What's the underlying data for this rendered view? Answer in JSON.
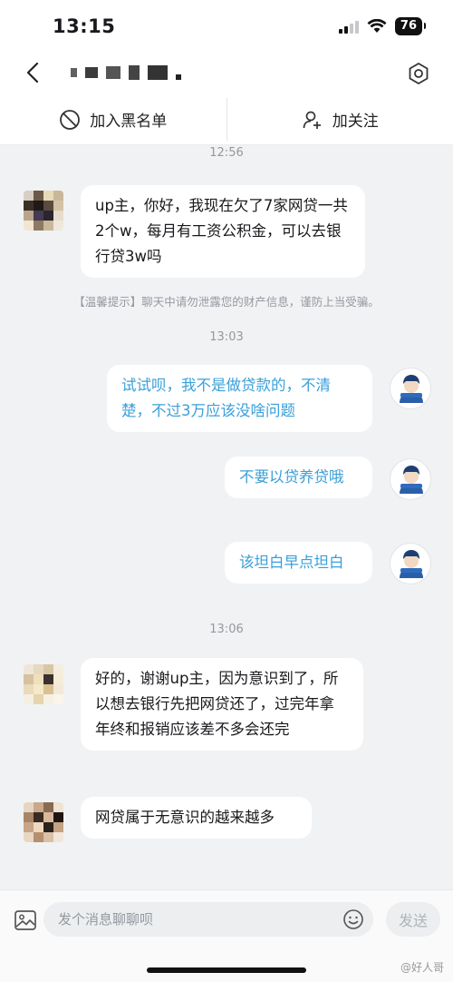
{
  "status": {
    "time": "13:15",
    "battery": "76"
  },
  "nav": {
    "title": "",
    "back_icon": "chevron-left-icon",
    "settings_icon": "hexagon-settings-icon"
  },
  "actions": {
    "block_label": "加入黑名单",
    "follow_label": "加关注"
  },
  "messages": {
    "ts1": "12:56",
    "m1": "up主，你好，我现在欠了7家网贷一共2个w，每月有工资公积金，可以去银行贷3w吗",
    "notice": "【温馨提示】聊天中请勿泄露您的财产信息，谨防上当受骗。",
    "ts2": "13:03",
    "m2": "试试呗，我不是做贷款的，不清楚，不过3万应该没啥问题",
    "m3": "不要以贷养贷哦",
    "m4": "该坦白早点坦白",
    "ts3": "13:06",
    "m5": "好的，谢谢up主，因为意识到了，所以想去银行先把网贷还了，过完年拿年终和报销应该差不多会还完",
    "m6": "网贷属于无意识的越来越多"
  },
  "input": {
    "placeholder": "发个消息聊聊呗",
    "send_label": "发送"
  },
  "watermark": "@好人哥",
  "colors": {
    "chat_bg": "#f1f2f3",
    "outgoing_text": "#3a9fd8",
    "timestamp": "#9499a0"
  }
}
